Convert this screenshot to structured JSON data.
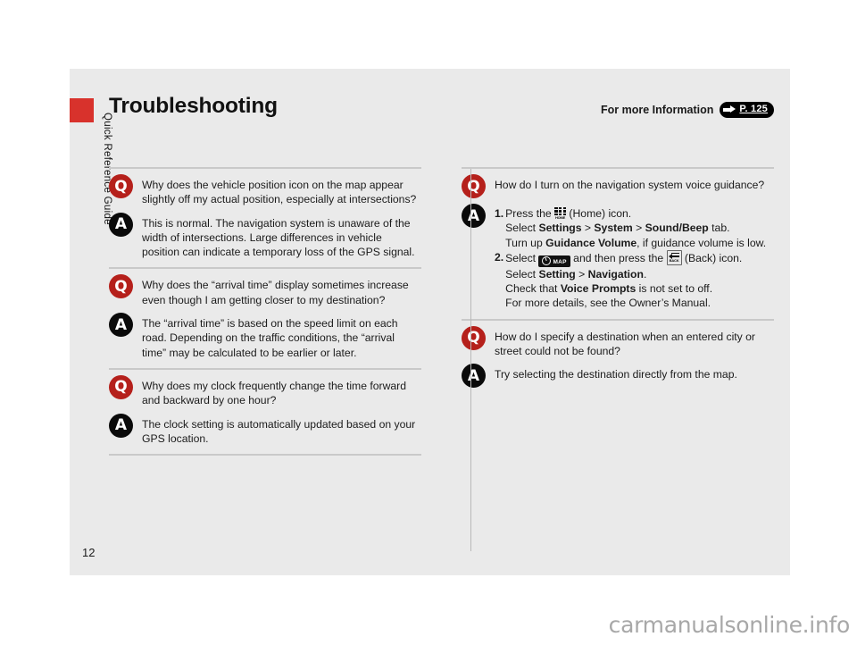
{
  "document": {
    "title": "Troubleshooting",
    "chapter_label": "Quick Reference Guide",
    "page_number": "12",
    "watermark": "carmanualsonline.info",
    "reference": {
      "label": "For more Information",
      "page_ref": "P. 125",
      "arrow_icon": "right-arrow-icon"
    },
    "colors": {
      "tab_red": "#d8322c",
      "question_badge": "#b5201b",
      "answer_badge": "#0a0a0a",
      "page_background": "#eaeaea",
      "rule": "#c9c9c9"
    }
  },
  "badges": {
    "question": "Q",
    "answer": "A"
  },
  "columns": {
    "left": [
      {
        "question": "Why does the vehicle position icon on the map appear slightly off my actual position, especially at intersections?",
        "answer": "This is normal. The navigation system is unaware of the width of intersections. Large differences in vehicle position can indicate a temporary loss of the GPS signal."
      },
      {
        "question": "Why does the “arrival time” display sometimes increase even though I am getting closer to my destination?",
        "answer": "The “arrival time” is based on the speed limit on each road. Depending on the traffic conditions, the “arrival time” may be calculated to be earlier or later."
      },
      {
        "question": "Why does my clock frequently change the time forward and backward by one hour?",
        "answer": "The clock setting is automatically updated based on your GPS location."
      }
    ],
    "right": {
      "voice_guidance": {
        "question": "How do I turn on the navigation system voice guidance?",
        "steps": [
          {
            "number": "1.",
            "lines": [
              {
                "segments": [
                  {
                    "type": "text",
                    "value": "Press the "
                  },
                  {
                    "type": "icon",
                    "value": "home-button-icon",
                    "label": "HOME"
                  },
                  {
                    "type": "text",
                    "value": " (Home) icon."
                  }
                ]
              },
              {
                "segments": [
                  {
                    "type": "text",
                    "value": "Select "
                  },
                  {
                    "type": "bold",
                    "value": "Settings"
                  },
                  {
                    "type": "text",
                    "value": " > "
                  },
                  {
                    "type": "bold",
                    "value": "System"
                  },
                  {
                    "type": "text",
                    "value": " > "
                  },
                  {
                    "type": "bold",
                    "value": "Sound/Beep"
                  },
                  {
                    "type": "text",
                    "value": " tab."
                  }
                ]
              },
              {
                "segments": [
                  {
                    "type": "text",
                    "value": "Turn up "
                  },
                  {
                    "type": "bold",
                    "value": "Guidance Volume"
                  },
                  {
                    "type": "text",
                    "value": ", if guidance volume is low."
                  }
                ]
              }
            ]
          },
          {
            "number": "2.",
            "lines": [
              {
                "segments": [
                  {
                    "type": "text",
                    "value": "Select "
                  },
                  {
                    "type": "icon",
                    "value": "map-button-icon",
                    "label": "MAP"
                  },
                  {
                    "type": "text",
                    "value": " and then press the "
                  },
                  {
                    "type": "icon",
                    "value": "back-button-icon",
                    "label": "BACK"
                  },
                  {
                    "type": "text",
                    "value": " (Back) icon."
                  }
                ]
              },
              {
                "segments": [
                  {
                    "type": "text",
                    "value": "Select "
                  },
                  {
                    "type": "bold",
                    "value": "Setting"
                  },
                  {
                    "type": "text",
                    "value": " > "
                  },
                  {
                    "type": "bold",
                    "value": "Navigation"
                  },
                  {
                    "type": "text",
                    "value": "."
                  }
                ]
              },
              {
                "segments": [
                  {
                    "type": "text",
                    "value": "Check that "
                  },
                  {
                    "type": "bold",
                    "value": "Voice Prompts"
                  },
                  {
                    "type": "text",
                    "value": " is not set to off."
                  }
                ]
              },
              {
                "segments": [
                  {
                    "type": "text",
                    "value": "For more details, see the Owner’s Manual."
                  }
                ]
              }
            ]
          }
        ]
      },
      "destination": {
        "question": "How do I specify a destination when an entered city or street could not be found?",
        "answer": "Try selecting the destination directly from the map."
      }
    }
  }
}
